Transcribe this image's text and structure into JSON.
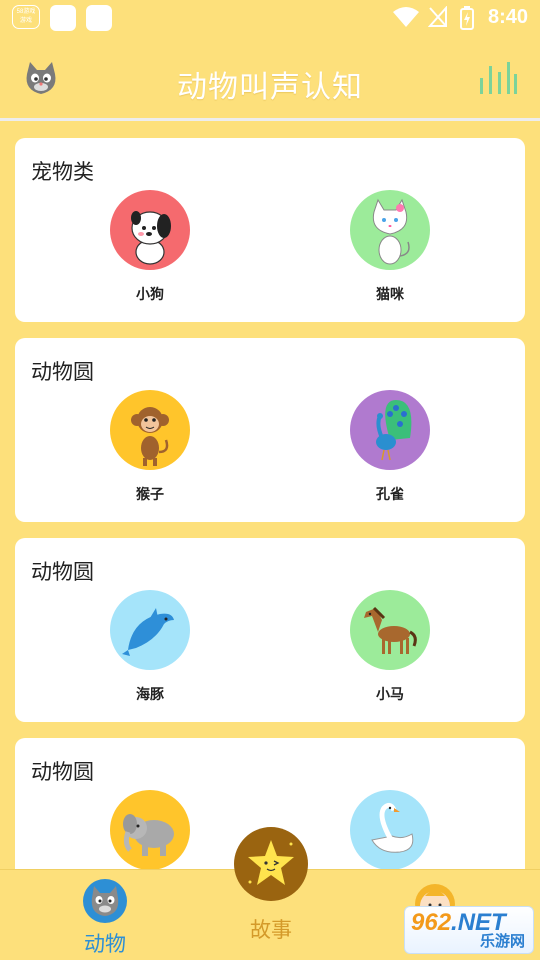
{
  "status_bar": {
    "app_badge_top": "58游戏",
    "app_badge_bottom": "游戏",
    "time": "8:40"
  },
  "header": {
    "title": "动物叫声认知",
    "left_icon": "cat-avatar-icon",
    "right_icon": "equalizer-bars-icon"
  },
  "sections": [
    {
      "title": "宠物类",
      "animals": [
        {
          "label": "小狗",
          "bg": "#F56A6E",
          "icon": "puppy-icon"
        },
        {
          "label": "猫咪",
          "bg": "#9CEB9A",
          "icon": "cat-icon"
        }
      ]
    },
    {
      "title": "动物圆",
      "animals": [
        {
          "label": "猴子",
          "bg": "#FFC52B",
          "icon": "monkey-icon"
        },
        {
          "label": "孔雀",
          "bg": "#B07ACF",
          "icon": "peacock-icon"
        }
      ]
    },
    {
      "title": "动物圆",
      "animals": [
        {
          "label": "海豚",
          "bg": "#A5E4FA",
          "icon": "dolphin-icon"
        },
        {
          "label": "小马",
          "bg": "#9CEB9A",
          "icon": "horse-icon"
        }
      ]
    },
    {
      "title": "动物圆",
      "animals": [
        {
          "label": "",
          "bg": "#FFC52B",
          "icon": "elephant-icon"
        },
        {
          "label": "",
          "bg": "#A5E4FA",
          "icon": "swan-icon"
        }
      ]
    }
  ],
  "bottom_nav": {
    "animals_label": "动物",
    "story_label": "故事"
  },
  "watermark": {
    "brand_a": "962",
    "brand_b": ".NET",
    "brand_c": "乐游网"
  },
  "colors": {
    "background": "#FDE07B",
    "accent_blue": "#2D8FD5",
    "accent_gold": "#D49A2A"
  }
}
